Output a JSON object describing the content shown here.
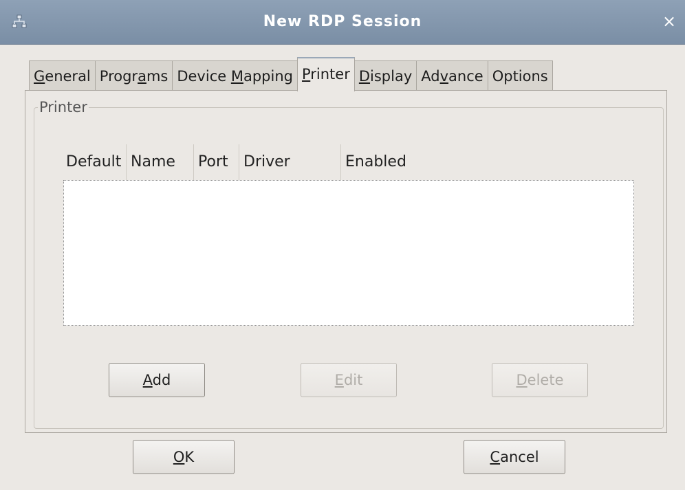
{
  "window": {
    "title": "New RDP Session",
    "close_symbol": "×"
  },
  "tabs": [
    {
      "pre": "",
      "key": "G",
      "post": "eneral",
      "active": false
    },
    {
      "pre": "Progr",
      "key": "a",
      "post": "ms",
      "active": false
    },
    {
      "pre": "Device ",
      "key": "M",
      "post": "apping",
      "active": false
    },
    {
      "pre": "",
      "key": "P",
      "post": "rinter",
      "active": true
    },
    {
      "pre": "",
      "key": "D",
      "post": "isplay",
      "active": false
    },
    {
      "pre": "Ad",
      "key": "v",
      "post": "ance",
      "active": false
    },
    {
      "pre": "Options",
      "key": "",
      "post": "",
      "active": false
    }
  ],
  "printer": {
    "group_label": "Printer",
    "columns": [
      "Default",
      "Name",
      "Port",
      "Driver",
      "Enabled"
    ],
    "rows": [],
    "add": {
      "key": "A",
      "rest": "dd",
      "enabled": true
    },
    "edit": {
      "key": "E",
      "rest": "dit",
      "enabled": false
    },
    "delete": {
      "key": "D",
      "rest": "elete",
      "enabled": false
    }
  },
  "footer": {
    "ok": {
      "key": "O",
      "rest": "K"
    },
    "cancel": {
      "key": "C",
      "rest": "ancel"
    }
  },
  "icons": {
    "app": "network-icon",
    "close": "close-icon"
  }
}
